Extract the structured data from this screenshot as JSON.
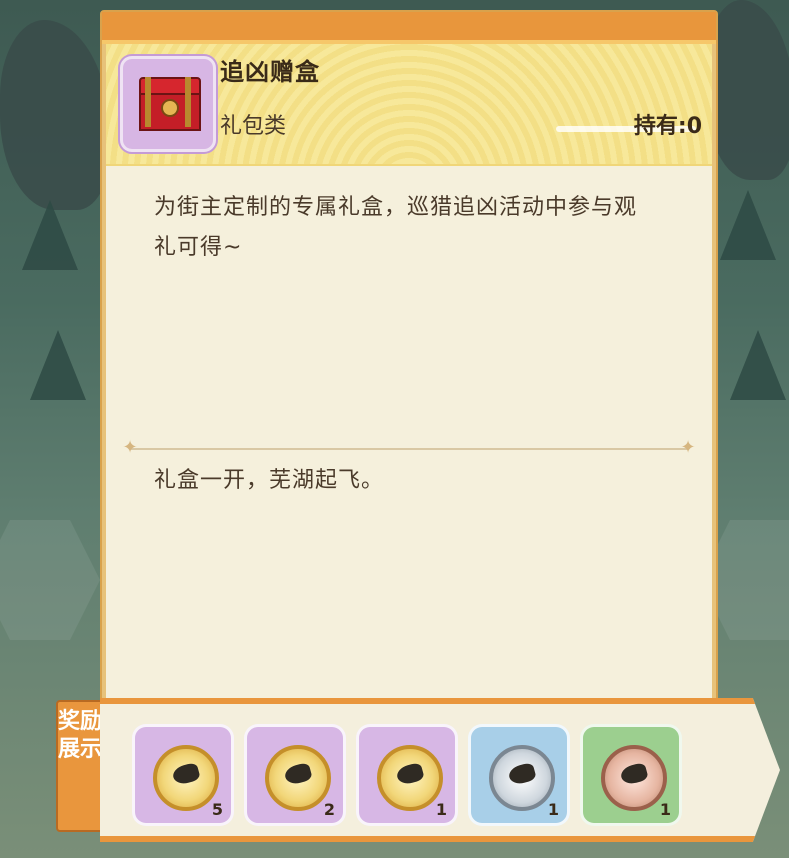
{
  "item": {
    "name": "追凶赠盒",
    "category": "礼包类",
    "hold_label": "持有:",
    "hold_count": "0",
    "description": "为街主定制的专属礼盒，巡猎追凶活动中参与观礼可得~",
    "flavor": "礼盒一开，芜湖起飞。"
  },
  "rewards": {
    "tab_label": "奖励展示",
    "items": [
      {
        "quantity": "5",
        "frame": "purple",
        "coin": "gold"
      },
      {
        "quantity": "2",
        "frame": "purple",
        "coin": "gold"
      },
      {
        "quantity": "1",
        "frame": "purple",
        "coin": "gold"
      },
      {
        "quantity": "1",
        "frame": "blue",
        "coin": "silver"
      },
      {
        "quantity": "1",
        "frame": "green",
        "coin": "bronze"
      }
    ]
  },
  "icons": {
    "item_icon": "red-chest-icon",
    "next_icon": "arrow-right-icon"
  },
  "colors": {
    "accent": "#e9963d",
    "header_yellow": "#f7e89a",
    "panel_bg": "#f5f0dc"
  }
}
